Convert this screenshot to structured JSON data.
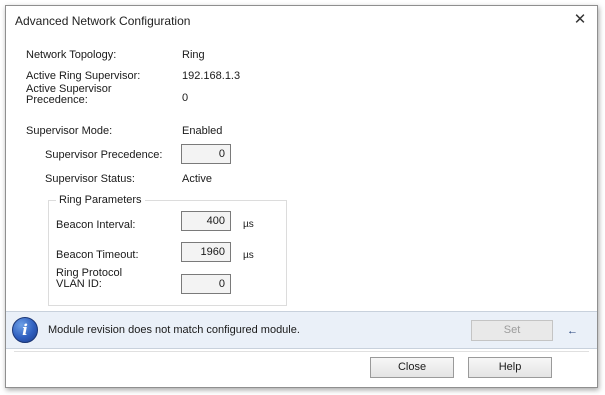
{
  "window": {
    "title": "Advanced Network Configuration",
    "close_glyph": "✕"
  },
  "summary": {
    "topology_label": "Network Topology:",
    "topology_value": "Ring",
    "ring_supervisor_label": "Active Ring Supervisor:",
    "ring_supervisor_value": "192.168.1.3",
    "supervisor_precedence_label": "Active Supervisor Precedence:",
    "supervisor_precedence_value": "0",
    "supervisor_mode_label": "Supervisor Mode:",
    "supervisor_mode_value": "Enabled"
  },
  "supervisor": {
    "precedence_label": "Supervisor Precedence:",
    "precedence_value": "0",
    "status_label": "Supervisor Status:",
    "status_value": "Active"
  },
  "ring_parameters": {
    "legend": "Ring Parameters",
    "beacon_interval_label": "Beacon Interval:",
    "beacon_interval_value": "400",
    "beacon_interval_unit": "µs",
    "beacon_timeout_label": "Beacon Timeout:",
    "beacon_timeout_value": "1960",
    "beacon_timeout_unit": "µs",
    "vlan_label": "Ring Protocol VLAN ID:",
    "vlan_value": "0"
  },
  "status": {
    "icon": "info-icon",
    "message": "Module revision does not match configured module.",
    "set_label": "Set",
    "arrow_glyph": "←"
  },
  "footer": {
    "close_label": "Close",
    "help_label": "Help"
  },
  "colors": {
    "status_bg": "#eaf0f8",
    "info_icon": "#2f5fbf"
  }
}
